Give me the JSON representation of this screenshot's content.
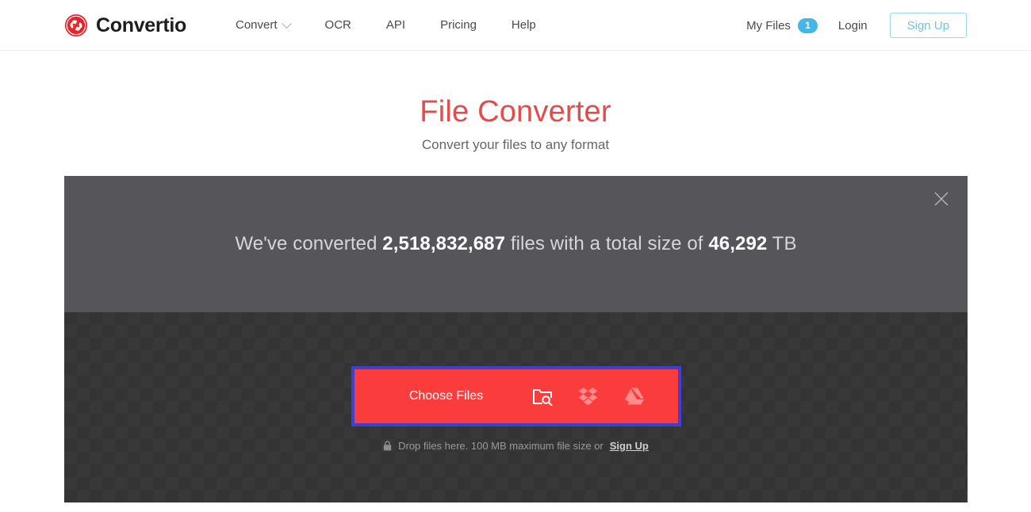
{
  "header": {
    "brand": {
      "name": "Convertio",
      "logo_icon": "convertio-logo-icon",
      "logo_color": "#E8242A"
    },
    "nav": [
      {
        "label": "Convert",
        "has_dropdown": true,
        "icon": "chevron-down-icon"
      },
      {
        "label": "OCR",
        "has_dropdown": false
      },
      {
        "label": "API",
        "has_dropdown": false
      },
      {
        "label": "Pricing",
        "has_dropdown": false
      },
      {
        "label": "Help",
        "has_dropdown": false
      }
    ],
    "my_files": {
      "label": "My Files",
      "count": "1",
      "badge_color": "#45B6E6"
    },
    "login": {
      "label": "Login"
    },
    "signup": {
      "label": "Sign Up",
      "border_color": "#9FD6EE",
      "text_color": "#6FC2E4"
    }
  },
  "hero": {
    "title": "File Converter",
    "title_color": "#E14C4C",
    "subtitle": "Convert your files to any format"
  },
  "panel": {
    "stats": {
      "prefix": "We've converted ",
      "files_count": "2,518,832,687",
      "middle": " files with a total size of ",
      "size_value": "46,292",
      "suffix": " TB",
      "close_icon": "close-icon"
    },
    "dropzone": {
      "choose_files_label": "Choose Files",
      "button_color": "#FA3C3C",
      "focus_ring_color": "#3F3FD0",
      "sources": [
        {
          "name": "folder-search-icon",
          "title": "From Computer"
        },
        {
          "name": "dropbox-icon",
          "title": "From Dropbox"
        },
        {
          "name": "google-drive-icon",
          "title": "From Google Drive"
        }
      ],
      "hint_icon": "lock-icon",
      "hint_text": "Drop files here. 100 MB maximum file size or",
      "hint_link": "Sign Up"
    }
  }
}
